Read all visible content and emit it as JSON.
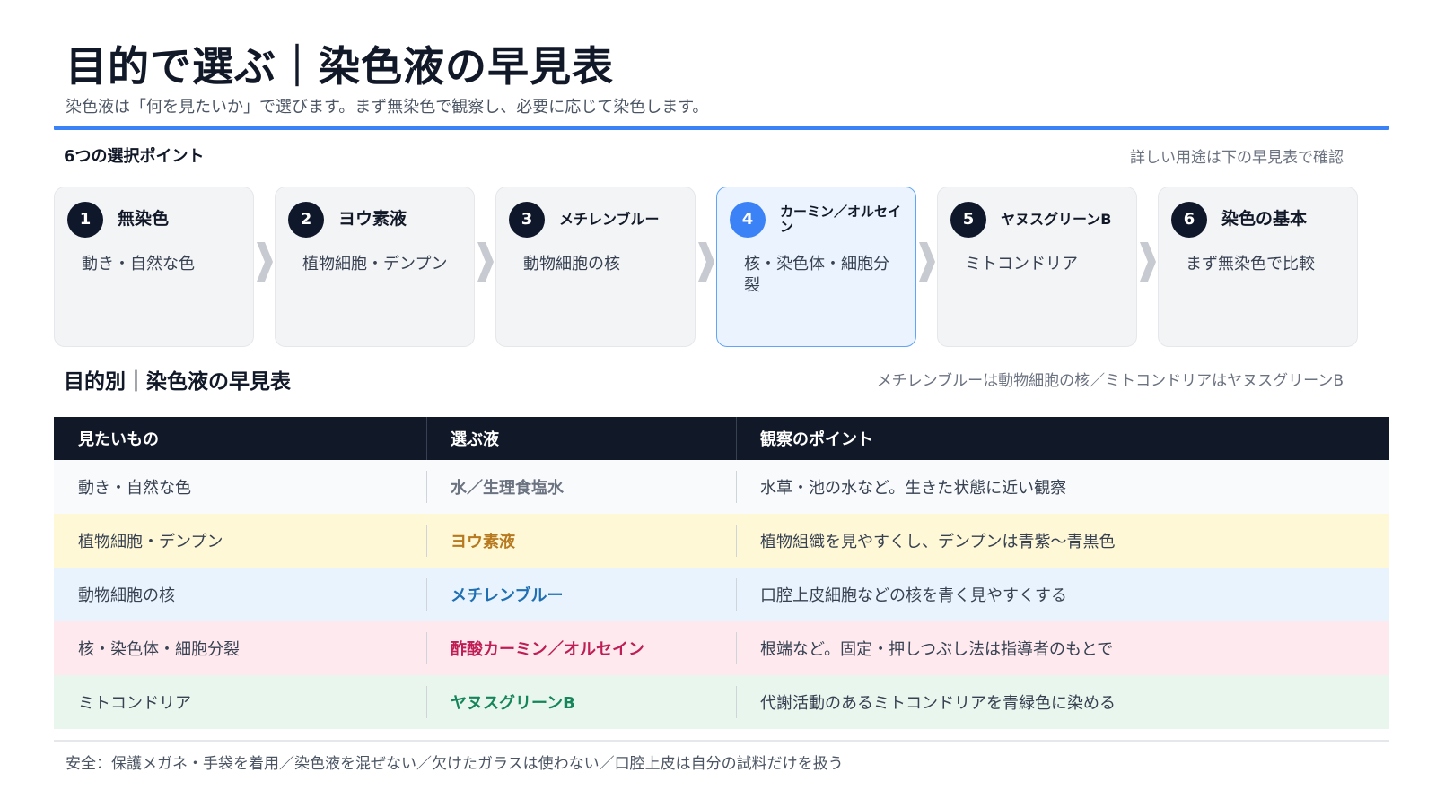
{
  "header": {
    "title": "目的で選ぶ｜染色液の早見表",
    "subtitle": "染色液は「何を見たいか」で選びます。まず無染色で観察し、必要に応じて染色します。"
  },
  "steps_section": {
    "heading": "6つの選択ポイント",
    "note": "詳しい用途は下の早見表で確認",
    "steps": [
      {
        "num": "1",
        "name": "無染色",
        "desc": "動き・自然な色"
      },
      {
        "num": "2",
        "name": "ヨウ素液",
        "desc": "植物細胞・デンプン"
      },
      {
        "num": "3",
        "name": "メチレンブルー",
        "desc": "動物細胞の核"
      },
      {
        "num": "4",
        "name": "カーミン／オルセイン",
        "desc": "核・染色体・細胞分裂"
      },
      {
        "num": "5",
        "name": "ヤヌスグリーンB",
        "desc": "ミトコンドリア"
      },
      {
        "num": "6",
        "name": "染色の基本",
        "desc": "まず無染色で比較"
      }
    ],
    "active_step": 4,
    "active_color": "#3b82f6",
    "chevron_color": "#c7cbd1"
  },
  "table_section": {
    "heading": "目的別｜染色液の早見表",
    "note": "メチレンブルーは動物細胞の核／ミトコンドリアはヤヌスグリーンB",
    "columns": [
      "見たいもの",
      "選ぶ液",
      "観察のポイント"
    ],
    "rows": [
      {
        "target": "動き・自然な色",
        "solution": "水／生理食塩水",
        "point": "水草・池の水など。生きた状態に近い観察",
        "bg": "#f8fafc",
        "accent": "#6b7280"
      },
      {
        "target": "植物細胞・デンプン",
        "solution": "ヨウ素液",
        "point": "植物組織を見やすくし、デンプンは青紫〜青黒色",
        "bg": "#fef8d6",
        "accent": "#b7791f"
      },
      {
        "target": "動物細胞の核",
        "solution": "メチレンブルー",
        "point": "口腔上皮細胞などの核を青く見やすくする",
        "bg": "#e9f3fd",
        "accent": "#1f6fb2"
      },
      {
        "target": "核・染色体・細胞分裂",
        "solution": "酢酸カーミン／オルセイン",
        "point": "根端など。固定・押しつぶし法は指導者のもとで",
        "bg": "#fde9ee",
        "accent": "#be1e55"
      },
      {
        "target": "ミトコンドリア",
        "solution": "ヤヌスグリーンB",
        "point": "代謝活動のあるミトコンドリアを青緑色に染める",
        "bg": "#e8f6ee",
        "accent": "#16855a"
      }
    ]
  },
  "footer": {
    "text": "安全：保護メガネ・手袋を着用／染色液を混ぜない／欠けたガラスは使わない／口腔上皮は自分の試料だけを扱う"
  }
}
